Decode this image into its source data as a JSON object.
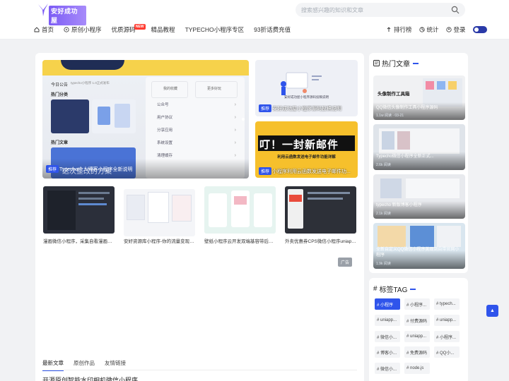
{
  "header": {
    "logo_text": "安好成功屋",
    "search_placeholder": "搜索感兴趣的知识和文章"
  },
  "nav": {
    "items": [
      {
        "label": "首页",
        "icon": "home-icon"
      },
      {
        "label": "原创小程序",
        "icon": "compass-icon"
      },
      {
        "label": "优质源码",
        "badge": "NEW"
      },
      {
        "label": "精品教程"
      },
      {
        "label": "TYPECHO小程序专区"
      },
      {
        "label": "93折话费充值"
      }
    ],
    "right": [
      {
        "label": "排行榜",
        "icon": "rank-icon"
      },
      {
        "label": "统计",
        "icon": "stats-icon"
      },
      {
        "label": "登录",
        "icon": "user-icon"
      }
    ]
  },
  "slider": {
    "main": {
      "tag": "推荐",
      "title": "Typecho个人博客小程序全新说明",
      "overlay_text": "这次整改的方案",
      "app": {
        "header_left": "今日公告",
        "header_sub": "typecho小程序 1.0正式发布",
        "hot_category": "热门分类",
        "hot_article": "热门文章",
        "profile_links": [
          "我的收藏",
          "更多好玩"
        ],
        "menu": [
          "公众号",
          "用户协议",
          "分享应用",
          "系统设置",
          "清理缓存"
        ]
      }
    },
    "side1": {
      "tag": "推荐",
      "title": "安好成功屋小程序源码投稿说明"
    },
    "side2": {
      "tag": "推荐",
      "title": "小程序利用云函数发送电子邮件功...",
      "banner": "叮！一封新邮件",
      "sub": "利用云函数发送电子邮件功能详解"
    }
  },
  "posts": [
    {
      "title": "漫画微信小程序，采集自看漫画网..."
    },
    {
      "title": "安好资源库小程序-你的流量变现神器"
    },
    {
      "title": "壁纸小程序云开发双端基容带后台..."
    },
    {
      "title": "外卖优惠券CPS微信小程序uniapp..."
    }
  ],
  "ad_label": "广告",
  "tabs": [
    {
      "label": "最新文章",
      "active": true
    },
    {
      "label": "原创作品",
      "active": false
    },
    {
      "label": "友情链接",
      "active": false
    }
  ],
  "latest_title": "开源原创智能水印相机微信小程序",
  "hot": {
    "title": "热门文章",
    "items": [
      {
        "title": "QQ微信头像制作工具小程序源码",
        "meta": "1.1w 阅读 · 03-21",
        "banner": "头像制作工具箱"
      },
      {
        "title": "Typecho微信小程序全新正式...",
        "meta": "2.6k 阅读"
      },
      {
        "title": "typecho 新版博客小程序",
        "meta": "2.1k 阅读"
      },
      {
        "title": "全新自定义QQ微信小程序美观到自带官网小程序",
        "meta": "1.9k 阅读"
      }
    ]
  },
  "tags": {
    "title": "标签TAG",
    "items": [
      {
        "label": "# 小程序",
        "active": true
      },
      {
        "label": "# 小程序...",
        "active": false
      },
      {
        "label": "# typech...",
        "active": false
      },
      {
        "label": "# uniapp...",
        "active": false
      },
      {
        "label": "# 付费源码",
        "active": false
      },
      {
        "label": "# uniapp...",
        "active": false
      },
      {
        "label": "# 微信小...",
        "active": false
      },
      {
        "label": "# uniapp...",
        "active": false
      },
      {
        "label": "# 小程序...",
        "active": false
      },
      {
        "label": "# 博客小...",
        "active": false
      },
      {
        "label": "# 免费源码",
        "active": false
      },
      {
        "label": "# QQ小...",
        "active": false
      },
      {
        "label": "# 微信小...",
        "active": false
      },
      {
        "label": "# node.js",
        "active": false
      }
    ]
  },
  "colors": {
    "accent": "#2f54eb",
    "new_badge": "#ff3b30",
    "dark_toggle": "#2a3aa8"
  }
}
